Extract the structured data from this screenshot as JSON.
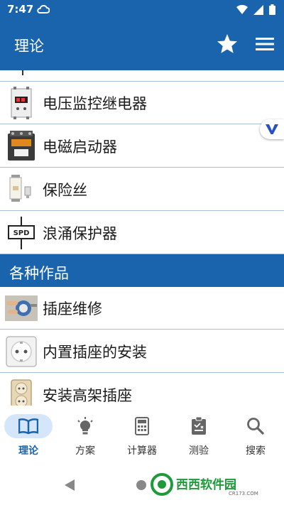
{
  "status_bar": {
    "time": "7:47"
  },
  "app_bar": {
    "title": "理论"
  },
  "list": {
    "items": [
      {
        "label": "电压监控继电器",
        "icon": "din-relay-icon"
      },
      {
        "label": "电磁启动器",
        "icon": "contactor-icon"
      },
      {
        "label": "保险丝",
        "icon": "fuse-icon"
      },
      {
        "label": "浪涌保护器",
        "icon": "spd-icon",
        "icon_text": "SPD"
      }
    ],
    "section": {
      "title": "各种作品",
      "items": [
        {
          "label": "插座维修",
          "icon": "socket-repair-photo"
        },
        {
          "label": "内置插座的安装",
          "icon": "wall-socket-icon"
        },
        {
          "label": "安装高架插座",
          "icon": "surface-socket-icon"
        }
      ]
    }
  },
  "bottom_nav": {
    "items": [
      {
        "label": "理论",
        "icon": "book-icon",
        "active": true
      },
      {
        "label": "方案",
        "icon": "lightbulb-icon",
        "active": false
      },
      {
        "label": "计算器",
        "icon": "calculator-icon",
        "active": false
      },
      {
        "label": "测验",
        "icon": "clipboard-icon",
        "active": false
      },
      {
        "label": "搜索",
        "icon": "search-icon",
        "active": false
      }
    ]
  },
  "watermark": {
    "text": "西西软件园",
    "url_text": "CR173.COM"
  },
  "colors": {
    "primary": "#1a63ad",
    "active_pill": "#d6e6fa",
    "divider": "#a9bfd9"
  }
}
